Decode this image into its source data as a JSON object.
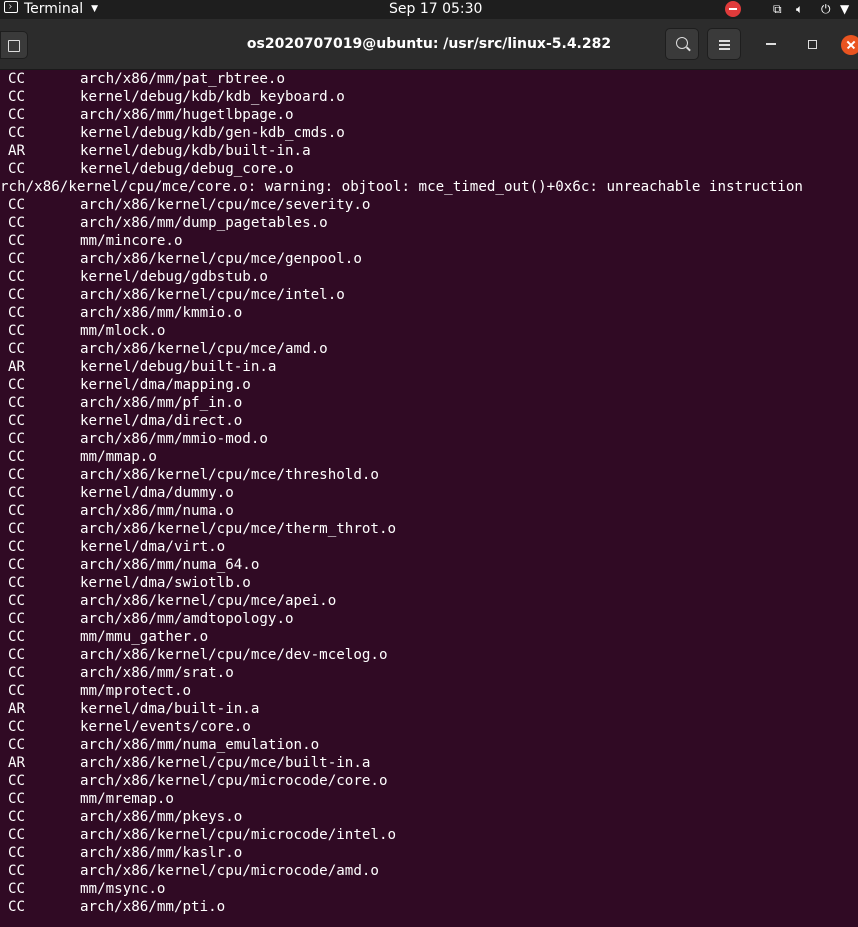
{
  "topbar": {
    "app_label": "Terminal",
    "clock": "Sep 17  05:30"
  },
  "window": {
    "title": "os2020707019@ubuntu: /usr/src/linux-5.4.282"
  },
  "terminal": {
    "lines": [
      {
        "cmd": "CC",
        "path": "arch/x86/mm/pat_rbtree.o"
      },
      {
        "cmd": "CC",
        "path": "kernel/debug/kdb/kdb_keyboard.o"
      },
      {
        "cmd": "CC",
        "path": "arch/x86/mm/hugetlbpage.o"
      },
      {
        "cmd": "CC",
        "path": "kernel/debug/kdb/gen-kdb_cmds.o"
      },
      {
        "cmd": "AR",
        "path": "kernel/debug/kdb/built-in.a"
      },
      {
        "cmd": "CC",
        "path": "kernel/debug/debug_core.o"
      },
      {
        "full": "rch/x86/kernel/cpu/mce/core.o: warning: objtool: mce_timed_out()+0x6c: unreachable instruction"
      },
      {
        "cmd": "CC",
        "path": "arch/x86/kernel/cpu/mce/severity.o"
      },
      {
        "cmd": "CC",
        "path": "arch/x86/mm/dump_pagetables.o"
      },
      {
        "cmd": "CC",
        "path": "mm/mincore.o"
      },
      {
        "cmd": "CC",
        "path": "arch/x86/kernel/cpu/mce/genpool.o"
      },
      {
        "cmd": "CC",
        "path": "kernel/debug/gdbstub.o"
      },
      {
        "cmd": "CC",
        "path": "arch/x86/kernel/cpu/mce/intel.o"
      },
      {
        "cmd": "CC",
        "path": "arch/x86/mm/kmmio.o"
      },
      {
        "cmd": "CC",
        "path": "mm/mlock.o"
      },
      {
        "cmd": "CC",
        "path": "arch/x86/kernel/cpu/mce/amd.o"
      },
      {
        "cmd": "AR",
        "path": "kernel/debug/built-in.a"
      },
      {
        "cmd": "CC",
        "path": "kernel/dma/mapping.o"
      },
      {
        "cmd": "CC",
        "path": "arch/x86/mm/pf_in.o"
      },
      {
        "cmd": "CC",
        "path": "kernel/dma/direct.o"
      },
      {
        "cmd": "CC",
        "path": "arch/x86/mm/mmio-mod.o"
      },
      {
        "cmd": "CC",
        "path": "mm/mmap.o"
      },
      {
        "cmd": "CC",
        "path": "arch/x86/kernel/cpu/mce/threshold.o"
      },
      {
        "cmd": "CC",
        "path": "kernel/dma/dummy.o"
      },
      {
        "cmd": "CC",
        "path": "arch/x86/mm/numa.o"
      },
      {
        "cmd": "CC",
        "path": "arch/x86/kernel/cpu/mce/therm_throt.o"
      },
      {
        "cmd": "CC",
        "path": "kernel/dma/virt.o"
      },
      {
        "cmd": "CC",
        "path": "arch/x86/mm/numa_64.o"
      },
      {
        "cmd": "CC",
        "path": "kernel/dma/swiotlb.o"
      },
      {
        "cmd": "CC",
        "path": "arch/x86/kernel/cpu/mce/apei.o"
      },
      {
        "cmd": "CC",
        "path": "arch/x86/mm/amdtopology.o"
      },
      {
        "cmd": "CC",
        "path": "mm/mmu_gather.o"
      },
      {
        "cmd": "CC",
        "path": "arch/x86/kernel/cpu/mce/dev-mcelog.o"
      },
      {
        "cmd": "CC",
        "path": "arch/x86/mm/srat.o"
      },
      {
        "cmd": "CC",
        "path": "mm/mprotect.o"
      },
      {
        "cmd": "AR",
        "path": "kernel/dma/built-in.a"
      },
      {
        "cmd": "CC",
        "path": "kernel/events/core.o"
      },
      {
        "cmd": "CC",
        "path": "arch/x86/mm/numa_emulation.o"
      },
      {
        "cmd": "AR",
        "path": "arch/x86/kernel/cpu/mce/built-in.a"
      },
      {
        "cmd": "CC",
        "path": "arch/x86/kernel/cpu/microcode/core.o"
      },
      {
        "cmd": "CC",
        "path": "mm/mremap.o"
      },
      {
        "cmd": "CC",
        "path": "arch/x86/mm/pkeys.o"
      },
      {
        "cmd": "CC",
        "path": "arch/x86/kernel/cpu/microcode/intel.o"
      },
      {
        "cmd": "CC",
        "path": "arch/x86/mm/kaslr.o"
      },
      {
        "cmd": "CC",
        "path": "arch/x86/kernel/cpu/microcode/amd.o"
      },
      {
        "cmd": "CC",
        "path": "mm/msync.o"
      },
      {
        "cmd": "CC",
        "path": "arch/x86/mm/pti.o"
      }
    ]
  },
  "colors": {
    "terminal_bg": "#300a24",
    "terminal_fg": "#ffffff",
    "headerbar_bg": "#2c2c2c",
    "topbar_bg": "#1e1e1e",
    "close_button": "#e95420"
  }
}
